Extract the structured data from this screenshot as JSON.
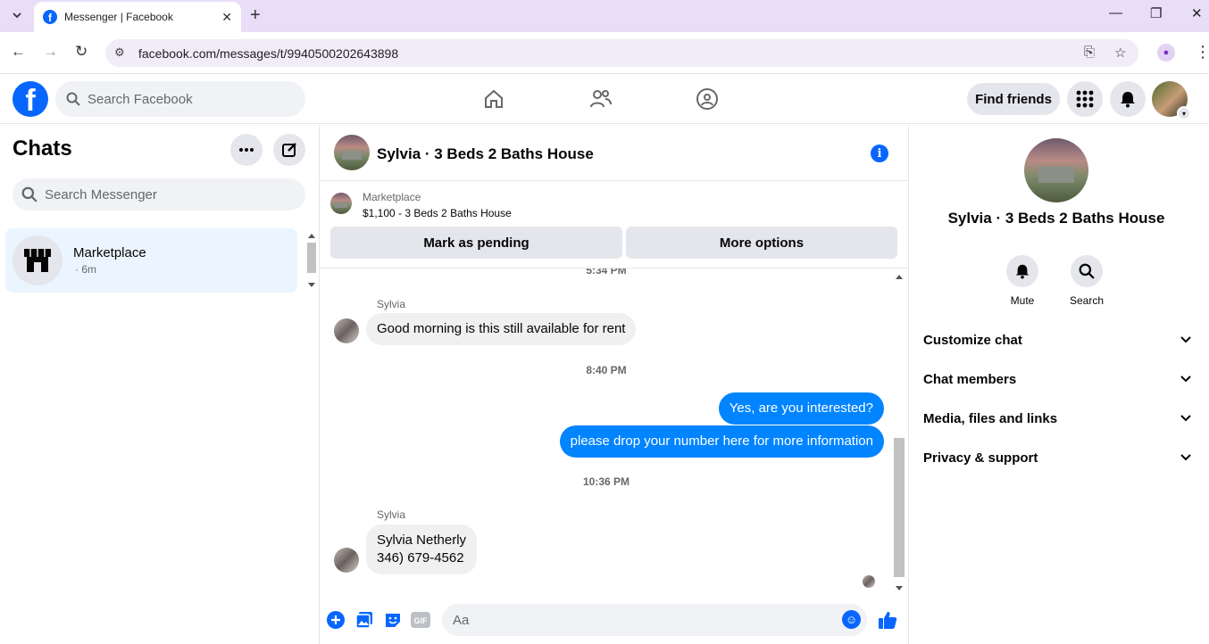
{
  "browser": {
    "tab_title": "Messenger | Facebook",
    "url": "facebook.com/messages/t/9940500202643898"
  },
  "header": {
    "search_placeholder": "Search Facebook",
    "find_friends": "Find friends"
  },
  "sidebar": {
    "title": "Chats",
    "search_placeholder": "Search Messenger",
    "chats": [
      {
        "name": "Marketplace",
        "time": "· 6m"
      }
    ]
  },
  "conversation": {
    "title": "Sylvia · 3 Beds 2 Baths House",
    "marketplace_label": "Marketplace",
    "listing": "$1,100 - 3 Beds 2 Baths House",
    "mark_pending": "Mark as pending",
    "more_options": "More options",
    "timestamps": [
      "5:34 PM",
      "8:40 PM",
      "10:36 PM"
    ],
    "messages": [
      {
        "sender": "Sylvia",
        "text": "Good morning is this still available for rent"
      },
      {
        "text": "Yes, are you interested?"
      },
      {
        "text": "please drop your number here for more information"
      },
      {
        "sender": "Sylvia",
        "line1": "Sylvia Netherly",
        "line2": "346) 679-4562"
      }
    ],
    "composer_placeholder": "Aa"
  },
  "details": {
    "name": "Sylvia · 3 Beds 2 Baths House",
    "mute": "Mute",
    "search": "Search",
    "sections": [
      "Customize chat",
      "Chat members",
      "Media, files and links",
      "Privacy & support"
    ]
  },
  "colors": {
    "brand": "#0866ff",
    "outgoing_bubble": "#0084ff",
    "selected_chat": "#ebf5ff"
  }
}
